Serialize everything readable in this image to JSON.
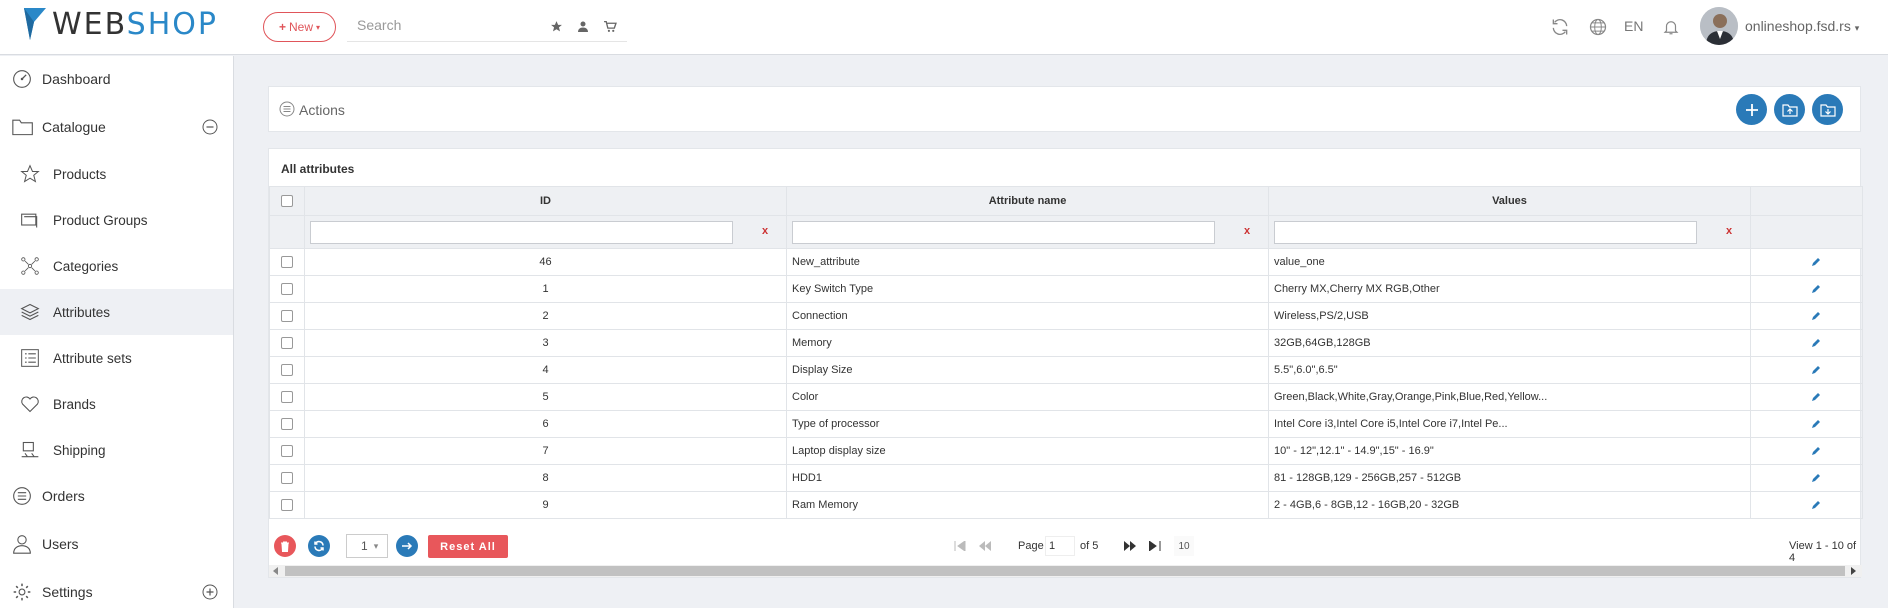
{
  "app": {
    "logo_main": "WEB",
    "logo_accent": "SHOP",
    "new_button": "New",
    "search_placeholder": "Search",
    "language": "EN",
    "shop_name": "onlineshop.fsd.rs"
  },
  "sidebar": {
    "items": [
      {
        "label": "Dashboard",
        "icon": "dashboard-icon"
      },
      {
        "label": "Catalogue",
        "icon": "folder-icon"
      },
      {
        "label": "Products",
        "icon": "star-icon"
      },
      {
        "label": "Product Groups",
        "icon": "groups-icon"
      },
      {
        "label": "Categories",
        "icon": "categories-icon"
      },
      {
        "label": "Attributes",
        "icon": "layers-icon"
      },
      {
        "label": "Attribute sets",
        "icon": "list-icon"
      },
      {
        "label": "Brands",
        "icon": "heart-icon"
      },
      {
        "label": "Shipping",
        "icon": "shipping-icon"
      },
      {
        "label": "Orders",
        "icon": "orders-icon"
      },
      {
        "label": "Users",
        "icon": "user-icon"
      },
      {
        "label": "Settings",
        "icon": "gear-icon"
      }
    ]
  },
  "actions": {
    "label": "Actions"
  },
  "table": {
    "title": "All attributes",
    "columns": [
      "ID",
      "Attribute name",
      "Values"
    ],
    "filter_clear": "x",
    "rows": [
      {
        "id": "46",
        "name": "New_attribute",
        "values": "value_one"
      },
      {
        "id": "1",
        "name": "Key Switch Type",
        "values": "Cherry MX,Cherry MX RGB,Other"
      },
      {
        "id": "2",
        "name": "Connection",
        "values": "Wireless,PS/2,USB"
      },
      {
        "id": "3",
        "name": "Memory",
        "values": "32GB,64GB,128GB"
      },
      {
        "id": "4",
        "name": "Display Size",
        "values": "5.5\",6.0\",6.5\""
      },
      {
        "id": "5",
        "name": "Color",
        "values": "Green,Black,White,Gray,Orange,Pink,Blue,Red,Yellow..."
      },
      {
        "id": "6",
        "name": "Type of processor",
        "values": "Intel Core i3,Intel Core i5,Intel Core i7,Intel Pe..."
      },
      {
        "id": "7",
        "name": "Laptop display size",
        "values": "10\" - 12\",12.1\" - 14.9\",15\" - 16.9\""
      },
      {
        "id": "8",
        "name": "HDD1",
        "values": "81 - 128GB,129 - 256GB,257 - 512GB"
      },
      {
        "id": "9",
        "name": "Ram Memory",
        "values": "2 - 4GB,6 - 8GB,12 - 16GB,20 - 32GB"
      }
    ]
  },
  "pager": {
    "page_select": "1",
    "reset_label": "Reset All",
    "page_label": "Page",
    "page_value": "1",
    "of_label": "of 5",
    "rows_per_page": "10",
    "view_info": "View 1 - 10 of 4"
  },
  "colors": {
    "accent": "#2a7ab8",
    "danger": "#e8575b",
    "brand_blue": "#2a88c8"
  }
}
